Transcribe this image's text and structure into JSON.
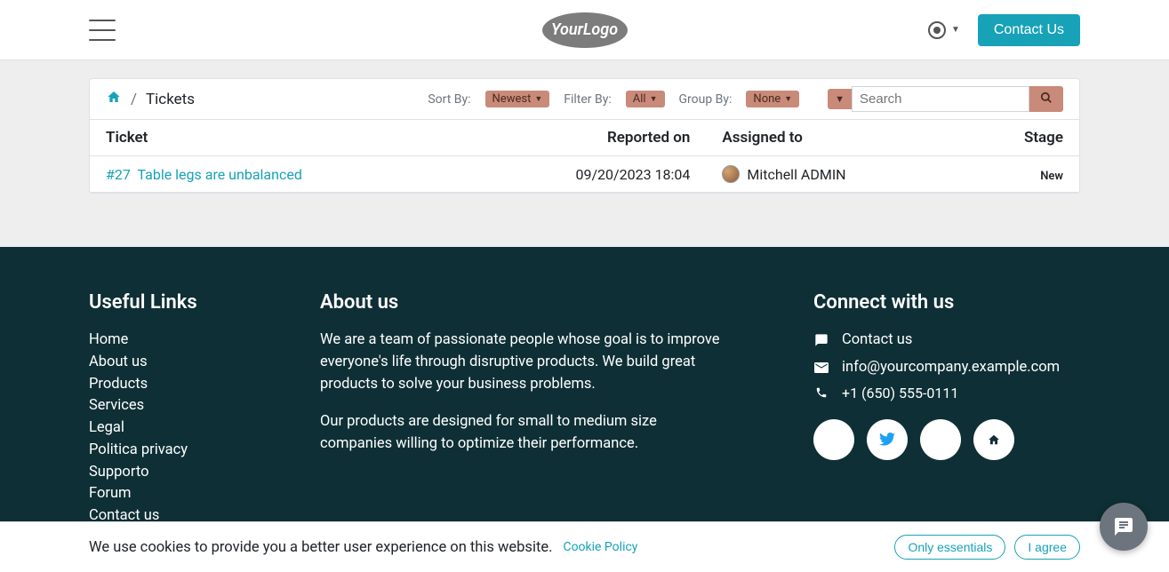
{
  "navbar": {
    "logo_text": "YourLogo",
    "contact_button": "Contact Us"
  },
  "breadcrumb": {
    "current": "Tickets",
    "separator": "/"
  },
  "filters": {
    "sort_label": "Sort By:",
    "sort_value": "Newest",
    "filter_label": "Filter By:",
    "filter_value": "All",
    "group_label": "Group By:",
    "group_value": "None",
    "search_placeholder": "Search"
  },
  "table": {
    "headers": {
      "ticket": "Ticket",
      "reported": "Reported on",
      "assigned": "Assigned to",
      "stage": "Stage"
    },
    "rows": [
      {
        "id": "#27",
        "title": "Table legs are unbalanced",
        "reported_on": "09/20/2023 18:04",
        "assigned_to": "Mitchell ADMIN",
        "stage": "New"
      }
    ]
  },
  "footer": {
    "links_header": "Useful Links",
    "links": [
      "Home",
      "About us",
      "Products",
      "Services",
      "Legal",
      "Politica privacy",
      "Supporto",
      "Forum",
      "Contact us"
    ],
    "about_header": "About us",
    "about_p1": "We are a team of passionate people whose goal is to improve everyone's life through disruptive products. We build great products to solve your business problems.",
    "about_p2": "Our products are designed for small to medium size companies willing to optimize their performance.",
    "connect_header": "Connect with us",
    "contact_link": "Contact us",
    "email": "info@yourcompany.example.com",
    "phone": "+1 (650) 555-0111"
  },
  "cookie": {
    "text": "We use cookies to provide you a better user experience on this website.",
    "policy_link": "Cookie Policy",
    "essentials_btn": "Only essentials",
    "agree_btn": "I agree"
  }
}
